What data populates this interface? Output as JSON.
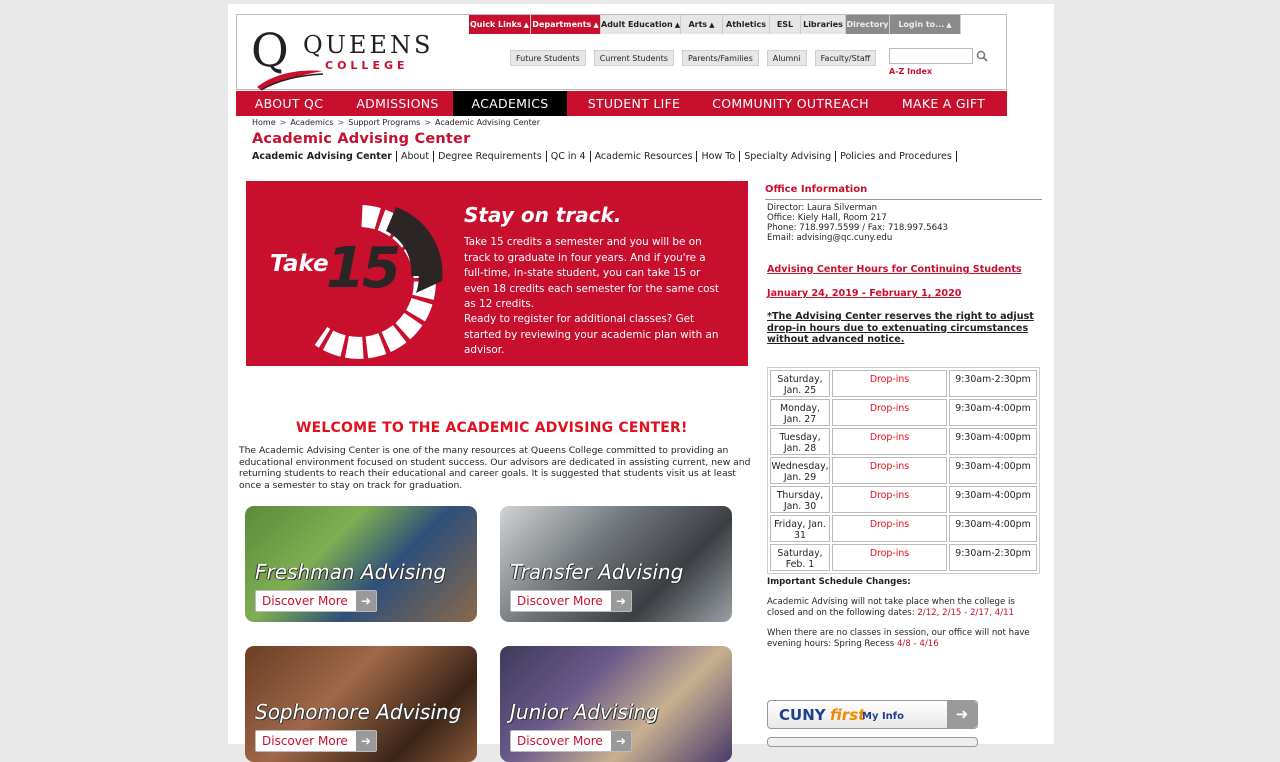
{
  "logo": {
    "letter": "Q",
    "name": "QUEENS",
    "sub": "COLLEGE"
  },
  "topbar": [
    {
      "label": "Quick Links",
      "arrow": "▲",
      "style": "red"
    },
    {
      "label": "Departments",
      "arrow": "▲",
      "style": "red"
    },
    {
      "label": "Adult Education",
      "arrow": "▲",
      "style": "plain"
    },
    {
      "label": "Arts",
      "arrow": "▲",
      "style": "plain"
    },
    {
      "label": "Athletics",
      "arrow": "",
      "style": "plain"
    },
    {
      "label": "ESL",
      "arrow": "",
      "style": "plain"
    },
    {
      "label": "Libraries",
      "arrow": "",
      "style": "plain"
    },
    {
      "label": "Directory",
      "arrow": "",
      "style": "grey"
    },
    {
      "label": "Login to...",
      "arrow": "▲",
      "style": "grey"
    }
  ],
  "audience": [
    "Future Students",
    "Current Students",
    "Parents/Families",
    "Alumni",
    "Faculty/Staff"
  ],
  "search": {
    "placeholder": "",
    "az": "A-Z Index"
  },
  "mainnav": [
    {
      "label": "ABOUT QC",
      "active": false
    },
    {
      "label": "ADMISSIONS",
      "active": false
    },
    {
      "label": "ACADEMICS",
      "active": true
    },
    {
      "label": "STUDENT LIFE",
      "active": false
    },
    {
      "label": "COMMUNITY OUTREACH",
      "active": false
    },
    {
      "label": "MAKE A GIFT",
      "active": false
    }
  ],
  "breadcrumb": [
    "Home",
    "Academics",
    "Support Programs",
    "Academic Advising Center"
  ],
  "page_title": "Academic Advising Center",
  "subnav": [
    "Academic Advising Center",
    "About",
    "Degree Requirements",
    "QC in 4",
    "Academic Resources",
    "How To",
    "Specialty Advising",
    "Policies and Procedures"
  ],
  "banner": {
    "take": "Take",
    "num": "15",
    "title": "Stay on track.",
    "text1": "Take 15 credits a semester and you will be on track to graduate in four years. And if you're a full-time, in-state student, you can take 15 or even 18 credits each semester for the same cost as 12 credits.",
    "text2": "Ready to register for additional classes? Get started by reviewing your academic plan with an advisor."
  },
  "welcome": "WELCOME TO THE ACADEMIC ADVISING CENTER!",
  "intro": "The Academic Advising Center is one of the many resources at Queens College committed to providing an educational environment focused on student success. Our advisors are dedicated in assisting current, new and returning students to reach their educational and career goals. It is suggested that students visit us at least once a semester to stay on track for graduation.",
  "tiles": [
    {
      "title": "Freshman Advising",
      "button": "Discover More"
    },
    {
      "title": "Transfer Advising",
      "button": "Discover More"
    },
    {
      "title": "Sophomore Advising",
      "button": "Discover More"
    },
    {
      "title": "Junior Advising",
      "button": "Discover More"
    }
  ],
  "office": {
    "title": "Office Information",
    "director": "Director: Laura Silverman",
    "office": "Office: Kiely Hall, Room 217",
    "phone": "Phone: 718.997.5599 / Fax: 718.997.5643",
    "email": "Email: advising@qc.cuny.edu"
  },
  "hours_link": "Advising Center Hours for Continuing Students",
  "date_range": "January 24, 2019 - February 1, 2020",
  "notice": "*The Advising Center reserves the right to adjust drop-in hours due to extenuating circumstances without advanced notice.",
  "hours": [
    {
      "day": "Saturday, Jan. 25",
      "type": "Drop-ins",
      "time": "9:30am-2:30pm"
    },
    {
      "day": "Monday, Jan. 27",
      "type": "Drop-ins",
      "time": "9:30am-4:00pm"
    },
    {
      "day": "Tuesday, Jan. 28",
      "type": "Drop-ins",
      "time": "9:30am-4:00pm"
    },
    {
      "day": "Wednesday, Jan. 29",
      "type": "Drop-ins",
      "time": "9:30am-4:00pm"
    },
    {
      "day": "Thursday, Jan. 30",
      "type": "Drop-ins",
      "time": "9:30am-4:00pm"
    },
    {
      "day": "Friday, Jan. 31",
      "type": "Drop-ins",
      "time": "9:30am-4:00pm"
    },
    {
      "day": "Saturday, Feb. 1",
      "type": "Drop-ins",
      "time": "9:30am-2:30pm"
    }
  ],
  "schedule": {
    "title": "Important Schedule Changes:",
    "p1": "Academic Advising will not take place when the college is closed and on the following dates:",
    "p1_dates": "2/12, 2/15 - 2/17, 4/11",
    "p2": "When there are no classes in session, our office will not have evening hours: Spring Recess",
    "p2_dates": "4/8 - 4/16"
  },
  "cuny": {
    "a": "CUNY",
    "b": "first",
    "c": "My Info"
  },
  "colors": {
    "brand": "#c8102e",
    "nav_active": "#000000",
    "page_bg": "#e9e9e9"
  }
}
